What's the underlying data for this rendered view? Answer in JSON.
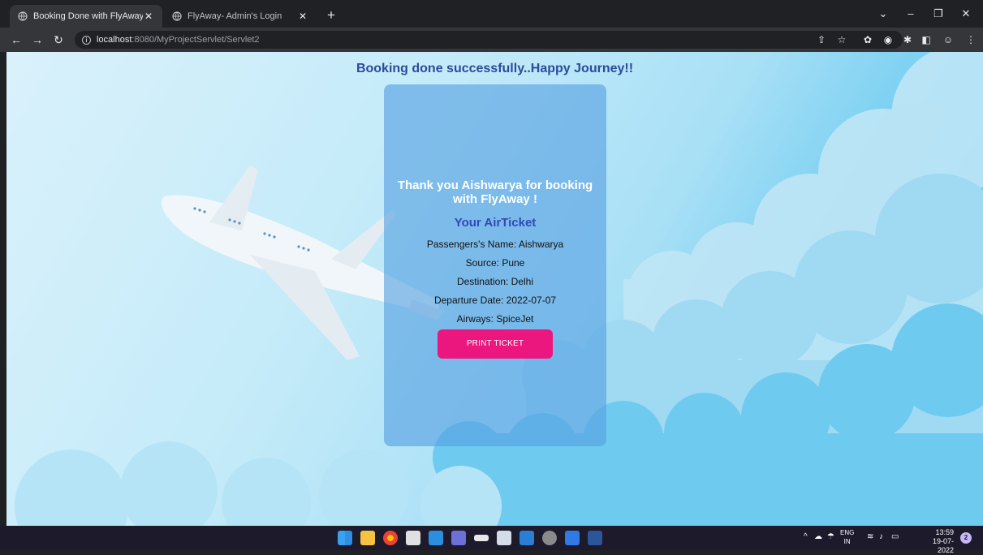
{
  "browser": {
    "tabs": [
      {
        "title": "Booking Done with FlyAway !!",
        "active": true
      },
      {
        "title": "FlyAway- Admin's Login",
        "active": false
      }
    ],
    "url_host": "localhost",
    "url_path": ":8080/MyProjectServlet/Servlet2"
  },
  "page": {
    "headline": "Booking done successfully..Happy Journey!!",
    "thanks": "Thank you Aishwarya for booking with FlyAway !",
    "ticket_heading": "Your AirTicket",
    "passenger": "Passengers's Name: Aishwarya",
    "source": "Source: Pune",
    "destination": "Destination: Delhi",
    "departure": "Departure Date: 2022-07-07",
    "airways": "Airways: SpiceJet",
    "print_button": "PRINT TICKET"
  },
  "taskbar": {
    "lang_top": "ENG",
    "lang_bottom": "IN",
    "time": "13:59",
    "date": "19-07-2022",
    "notifications": "2"
  },
  "colors": {
    "headline": "#2b4b9b",
    "ticket_heading": "#3248b8",
    "print_button": "#ec167f"
  }
}
